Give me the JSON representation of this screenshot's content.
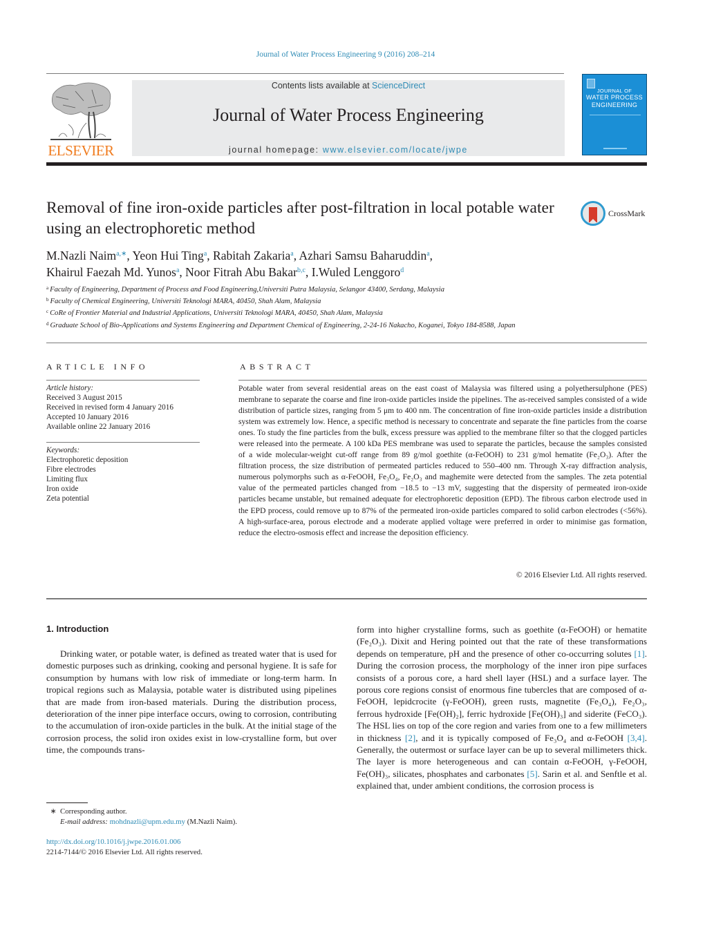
{
  "header": {
    "running_head": "Journal of Water Process Engineering 9 (2016) 208–214",
    "contents_prefix": "Contents lists available at ",
    "contents_link": "ScienceDirect",
    "journal_name": "Journal of Water Process Engineering",
    "homepage_prefix": "journal homepage: ",
    "homepage_link": "www.elsevier.com/locate/jwpe",
    "publisher_logo_text": "ELSEVIER",
    "cover_title_lines": [
      "JOURNAL OF",
      "WATER PROCESS",
      "ENGINEERING"
    ],
    "crossmark_label": "CrossMark"
  },
  "article": {
    "title": "Removal of fine iron-oxide particles after post-filtration in local potable water using an electrophoretic method",
    "authors": [
      {
        "name": "M.Nazli Naim",
        "sup": "a,∗",
        "sep": ", "
      },
      {
        "name": "Yeon Hui Ting",
        "sup": "a",
        "sep": ", "
      },
      {
        "name": "Rabitah Zakaria",
        "sup": "a",
        "sep": ", "
      },
      {
        "name": "Azhari Samsu Baharuddin",
        "sup": "a",
        "sep": ","
      },
      {
        "name": "Khairul Faezah Md. Yunos",
        "sup": "a",
        "sep": ", "
      },
      {
        "name": "Noor Fitrah Abu Bakar",
        "sup": "b,c",
        "sep": ", "
      },
      {
        "name": "I.Wuled Lenggoro",
        "sup": "d",
        "sep": ""
      }
    ],
    "affiliations": [
      {
        "key": "a",
        "text": "Faculty of Engineering, Department of Process and Food Engineering,Universiti Putra Malaysia, Selangor 43400, Serdang, Malaysia"
      },
      {
        "key": "b",
        "text": "Faculty of Chemical Engineering, Universiti Teknologi MARA, 40450, Shah Alam, Malaysia"
      },
      {
        "key": "c",
        "text": "CoRe of Frontier Material and Industrial Applications, Universiti Teknologi MARA, 40450, Shah Alam, Malaysia"
      },
      {
        "key": "d",
        "text": "Graduate School of Bio-Applications and Systems Engineering and Department Chemical of Engineering, 2-24-16 Nakacho, Koganei, Tokyo 184-8588, Japan"
      }
    ]
  },
  "article_info": {
    "label": "ARTICLE INFO",
    "history_head": "Article history:",
    "history": [
      "Received 3 August 2015",
      "Received in revised form 4 January 2016",
      "Accepted 10 January 2016",
      "Available online 22 January 2016"
    ],
    "keywords_head": "Keywords:",
    "keywords": [
      "Electrophoretic deposition",
      "Fibre electrodes",
      "Limiting flux",
      "Iron oxide",
      "Zeta potential"
    ]
  },
  "abstract": {
    "label": "ABSTRACT",
    "text": "Potable water from several residential areas on the east coast of Malaysia was filtered using a polyethersulphone (PES) membrane to separate the coarse and fine iron-oxide particles inside the pipelines. The as-received samples consisted of a wide distribution of particle sizes, ranging from 5 μm to 400 nm. The concentration of fine iron-oxide particles inside a distribution system was extremely low. Hence, a specific method is necessary to concentrate and separate the fine particles from the coarse ones. To study the fine particles from the bulk, excess pressure was applied to the membrane filter so that the clogged particles were released into the permeate. A 100 kDa PES membrane was used to separate the particles, because the samples consisted of a wide molecular-weight cut-off range from 89 g/mol goethite (α-FeOOH) to 231 g/mol hematite (Fe₂O₃). After the filtration process, the size distribution of permeated particles reduced to 550–400 nm. Through X-ray diffraction analysis, numerous polymorphs such as α-FeOOH, Fe₃O₄, Fe₂O₃ and maghemite were detected from the samples. The zeta potential value of the permeated particles changed from −18.5 to −13 mV, suggesting that the dispersity of permeated iron-oxide particles became unstable, but remained adequate for electrophoretic deposition (EPD). The fibrous carbon electrode used in the EPD process, could remove up to 87% of the permeated iron-oxide particles compared to solid carbon electrodes (<56%). A high-surface-area, porous electrode and a moderate applied voltage were preferred in order to minimise gas formation, reduce the electro-osmosis effect and increase the deposition efficiency.",
    "copyright": "© 2016 Elsevier Ltd. All rights reserved."
  },
  "introduction": {
    "heading": "1.  Introduction",
    "left_column": "Drinking water, or potable water, is defined as treated water that is used for domestic purposes such as drinking, cooking and personal hygiene. It is safe for consumption by humans with low risk of immediate or long-term harm. In tropical regions such as Malaysia, potable water is distributed using pipelines that are made from iron-based materials. During the distribution process, deterioration of the inner pipe interface occurs, owing to corrosion, contributing to the accumulation of iron-oxide particles in the bulk. At the initial stage of the corrosion process, the solid iron oxides exist in low-crystalline form, but over time, the compounds trans-",
    "right_column": [
      {
        "t": "form into higher crystalline forms, such as goethite (α-FeOOH) or hematite (Fe₂O₃). Dixit and Hering pointed out that the rate of these transformations depends on temperature, pH and the presence of other co-occurring solutes "
      },
      {
        "ref": "[1]"
      },
      {
        "t": ". During the corrosion process, the morphology of the inner iron pipe surfaces consists of a porous core, a hard shell layer (HSL) and a surface layer. The porous core regions consist of enormous fine tubercles that are composed of α-FeOOH, lepidcrocite (γ-FeOOH), green rusts, magnetite (Fe₃O₄), Fe₂O₃, ferrous hydroxide [Fe(OH)₂], ferric hydroxide [Fe(OH)₃] and siderite (FeCO₃). The HSL lies on top of the core region and varies from one to a few millimeters in thickness "
      },
      {
        "ref": "[2]"
      },
      {
        "t": ", and it is typically composed of Fe₃O₄ and α-FeOOH "
      },
      {
        "ref": "[3,4]"
      },
      {
        "t": ". Generally, the outermost or surface layer can be up to several millimeters thick. The layer is more heterogeneous and can contain α-FeOOH, γ-FeOOH, Fe(OH)₃, silicates, phosphates and carbonates "
      },
      {
        "ref": "[5]"
      },
      {
        "t": ". Sarin et al. and Senftle et al. explained that, under ambient conditions, the corrosion process is"
      }
    ]
  },
  "footnotes": {
    "star": "∗",
    "corresponding": "Corresponding author.",
    "email_label": "E-mail address: ",
    "email": "mohdnazli@upm.edu.my",
    "email_suffix": " (M.Nazli Naim).",
    "doi": "http://dx.doi.org/10.1016/j.jwpe.2016.01.006",
    "issn_line": "2214-7144/© 2016 Elsevier Ltd. All rights reserved."
  }
}
